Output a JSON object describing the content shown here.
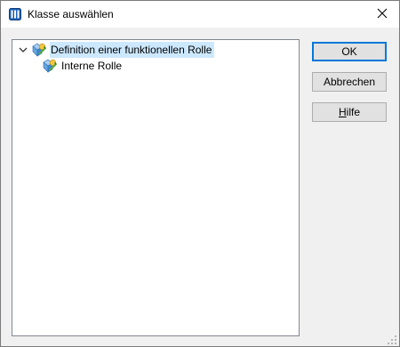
{
  "window": {
    "title": "Klasse auswählen",
    "app_icon": "window-icon",
    "close_icon": "close-icon"
  },
  "tree": {
    "nodes": [
      {
        "label": "Definition einer funktionellen Rolle",
        "expanded": true,
        "selected": true,
        "icon": "role-class-icon"
      },
      {
        "label": "Interne Rolle",
        "expanded": false,
        "selected": false,
        "icon": "role-class-icon"
      }
    ]
  },
  "buttons": {
    "ok": "OK",
    "cancel": "Abbrechen",
    "help_mnemonic": "H",
    "help_rest": "ilfe"
  },
  "colors": {
    "accent": "#0078d7",
    "selection": "#cce8ff",
    "dialog_bg": "#f0f0f0"
  }
}
